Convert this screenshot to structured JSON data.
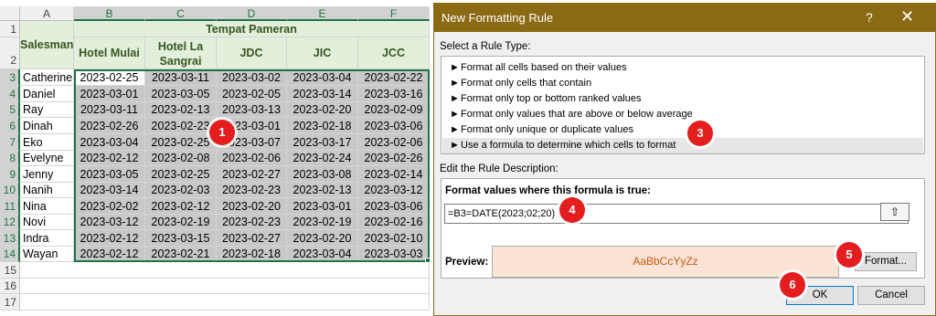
{
  "sheet": {
    "columns": [
      "A",
      "B",
      "C",
      "D",
      "E",
      "F"
    ],
    "row_numbers": [
      "1",
      "2",
      "3",
      "4",
      "5",
      "6",
      "7",
      "8",
      "9",
      "10",
      "11",
      "12",
      "13",
      "14",
      "15",
      "16",
      "17"
    ],
    "group_header": "Tempat Pameran",
    "salesman_header": "Salesman",
    "venue_headers": [
      "Hotel Mulai",
      "Hotel La Sangrai",
      "JDC",
      "JIC",
      "JCC"
    ],
    "rows": [
      {
        "name": "Catherine",
        "dates": [
          "2023-02-25",
          "2023-03-11",
          "2023-03-02",
          "2023-03-04",
          "2023-02-22"
        ]
      },
      {
        "name": "Daniel",
        "dates": [
          "2023-03-01",
          "2023-03-05",
          "2023-02-05",
          "2023-03-14",
          "2023-03-16"
        ]
      },
      {
        "name": "Ray",
        "dates": [
          "2023-03-11",
          "2023-02-13",
          "2023-03-13",
          "2023-02-20",
          "2023-02-09"
        ]
      },
      {
        "name": "Dinah",
        "dates": [
          "2023-02-26",
          "2023-02-23",
          "2023-03-01",
          "2023-02-18",
          "2023-03-06"
        ]
      },
      {
        "name": "Eko",
        "dates": [
          "2023-03-04",
          "2023-02-25",
          "2023-03-07",
          "2023-03-17",
          "2023-02-06"
        ]
      },
      {
        "name": "Evelyne",
        "dates": [
          "2023-02-12",
          "2023-02-08",
          "2023-02-06",
          "2023-02-24",
          "2023-02-26"
        ]
      },
      {
        "name": "Jenny",
        "dates": [
          "2023-03-05",
          "2023-02-25",
          "2023-02-27",
          "2023-03-08",
          "2023-02-14"
        ]
      },
      {
        "name": "Nanih",
        "dates": [
          "2023-03-14",
          "2023-02-03",
          "2023-02-23",
          "2023-02-13",
          "2023-03-12"
        ]
      },
      {
        "name": "Nina",
        "dates": [
          "2023-02-02",
          "2023-02-12",
          "2023-02-20",
          "2023-03-01",
          "2023-03-06"
        ]
      },
      {
        "name": "Novi",
        "dates": [
          "2023-03-12",
          "2023-02-19",
          "2023-02-23",
          "2023-02-19",
          "2023-02-16"
        ]
      },
      {
        "name": "Indra",
        "dates": [
          "2023-02-12",
          "2023-03-15",
          "2023-02-27",
          "2023-02-20",
          "2023-02-10"
        ]
      },
      {
        "name": "Wayan",
        "dates": [
          "2023-02-12",
          "2023-02-21",
          "2023-02-18",
          "2023-03-04",
          "2023-03-03"
        ]
      }
    ]
  },
  "dialog": {
    "title": "New Formatting Rule",
    "help": "?",
    "close": "✕",
    "select_rule_type_label": "Select a Rule Type:",
    "rule_arrow": "►",
    "rule_types": [
      "Format all cells based on their values",
      "Format only cells that contain",
      "Format only top or bottom ranked values",
      "Format only values that are above or below average",
      "Format only unique or duplicate values",
      "Use a formula to determine which cells to format"
    ],
    "selected_rule_index": 5,
    "edit_description_label": "Edit the Rule Description:",
    "formula_label": "Format values where this formula is true:",
    "formula_value": "=B3=DATE(2023;02;20)",
    "collapse_icon": "⇧",
    "preview_label": "Preview:",
    "preview_text": "AaBbCcYyZz",
    "format_button": "Format...",
    "ok_button": "OK",
    "cancel_button": "Cancel"
  },
  "markers": [
    "1",
    "3",
    "4",
    "5",
    "6"
  ],
  "colors": {
    "title_bar": "#8b6a14",
    "header_fill": "#e2efda",
    "selection": "#217346",
    "marker": "#e41e1e",
    "preview_fill": "#fbe4d6"
  }
}
